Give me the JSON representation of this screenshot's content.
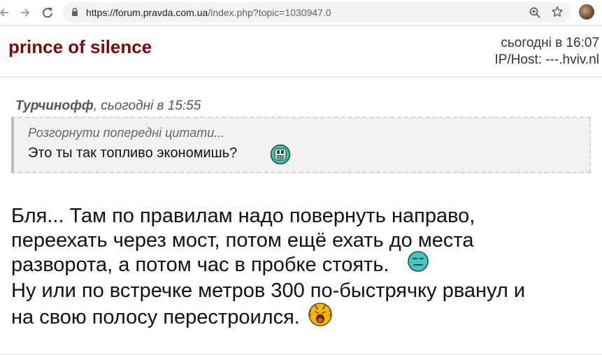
{
  "browser": {
    "url_domain": "https://forum.pravda.com.ua",
    "url_path": "/index.php?topic=1030947.0"
  },
  "post": {
    "username": "prince of silence",
    "date": "сьогодні в 16:07",
    "ip_host": "IP/Host: ---.hviv.nl"
  },
  "quote": {
    "author": "Турчинофф",
    "author_suffix": ", сьогодні в 15:55",
    "expand_label": "Розгорнути попередні цитати...",
    "text": "Это ты так топливо экономишь?",
    "emoticon": "scared-face-icon"
  },
  "body": {
    "lines": [
      "Бля... Там по правилам надо повернуть направо,",
      "переехать через мост, потом ещё ехать до места",
      "разворота, а потом час в пробке стоять.",
      "Ну или по встречке метров 300 по-быстрячку рванул и",
      "на свою полосу перестроился."
    ],
    "emoticons": [
      "sad-face-icon",
      "laughing-face-icon"
    ]
  },
  "colors": {
    "username": "#7a0a0a",
    "quote_bg": "#f2f2f2"
  }
}
